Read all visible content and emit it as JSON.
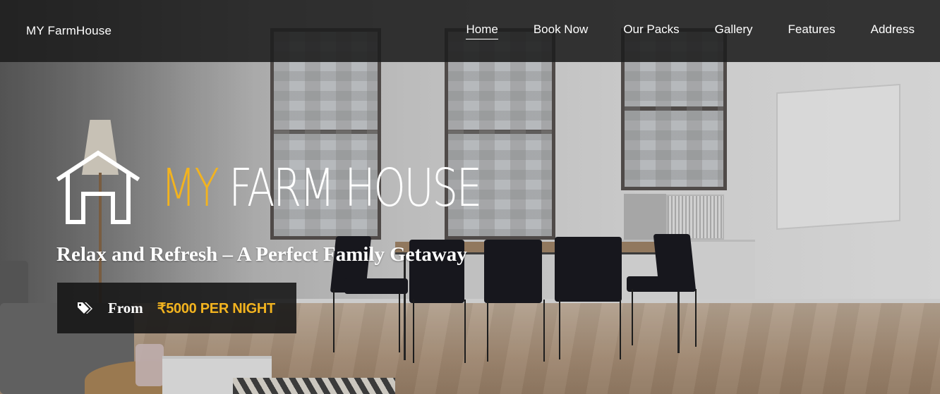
{
  "nav": {
    "brand": "MY FarmHouse",
    "items": [
      {
        "label": "Home",
        "active": true
      },
      {
        "label": "Book Now",
        "active": false
      },
      {
        "label": "Our Packs",
        "active": false
      },
      {
        "label": "Gallery",
        "active": false
      },
      {
        "label": "Features",
        "active": false
      },
      {
        "label": "Address",
        "active": false
      }
    ]
  },
  "hero": {
    "logo_my": "MY",
    "logo_rest": "FARM HOUSE",
    "house_icon": "house-outline-icon",
    "tagline": "Relax and Refresh – A Perfect Family Getaway",
    "price_icon": "tags-icon",
    "from_label": "From",
    "price": "₹5000 PER NIGHT"
  },
  "colors": {
    "accent": "#f2b31f",
    "navbar_bg": "#1c1c1c",
    "text_light": "#ffffff",
    "price_box_bg": "#141414"
  }
}
